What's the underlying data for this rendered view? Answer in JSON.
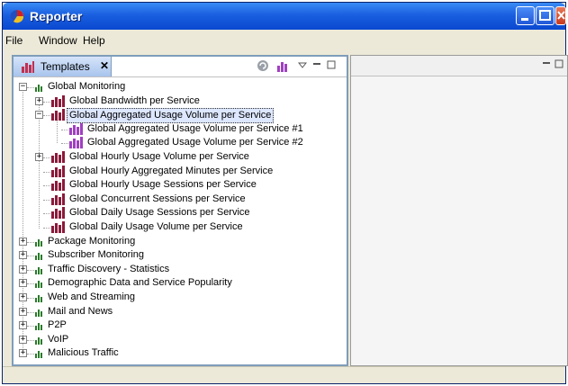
{
  "window": {
    "title": "Reporter"
  },
  "menu": [
    "File",
    "Window",
    "Help"
  ],
  "left_panel": {
    "tab_label": "Templates",
    "tab_close": "✕"
  },
  "tree": [
    {
      "label": "Global Monitoring",
      "level": 0,
      "icon": "folder",
      "expander": "−"
    },
    {
      "label": "Global Bandwidth per Service",
      "level": 1,
      "icon": "bar",
      "expander": "+"
    },
    {
      "label": "Global Aggregated Usage Volume per Service",
      "level": 1,
      "icon": "bar",
      "expander": "−",
      "selected": true
    },
    {
      "label": "Global Aggregated Usage Volume per Service #1",
      "level": 2,
      "icon": "bar-purple"
    },
    {
      "label": "Global Aggregated Usage Volume per Service #2",
      "level": 2,
      "icon": "bar-purple"
    },
    {
      "label": "Global Hourly Usage Volume per Service",
      "level": 1,
      "icon": "bar",
      "expander": "+"
    },
    {
      "label": "Global Hourly Aggregated Minutes per Service",
      "level": 1,
      "icon": "bar"
    },
    {
      "label": "Global Hourly Usage Sessions per Service",
      "level": 1,
      "icon": "bar"
    },
    {
      "label": "Global Concurrent Sessions per Service",
      "level": 1,
      "icon": "bar"
    },
    {
      "label": "Global Daily Usage Sessions per Service",
      "level": 1,
      "icon": "bar"
    },
    {
      "label": "Global Daily Usage Volume per Service",
      "level": 1,
      "icon": "bar"
    },
    {
      "label": "Package Monitoring",
      "level": 0,
      "icon": "folder",
      "expander": "+"
    },
    {
      "label": "Subscriber Monitoring",
      "level": 0,
      "icon": "folder",
      "expander": "+"
    },
    {
      "label": "Traffic Discovery - Statistics",
      "level": 0,
      "icon": "folder",
      "expander": "+"
    },
    {
      "label": "Demographic Data and Service Popularity",
      "level": 0,
      "icon": "folder",
      "expander": "+"
    },
    {
      "label": "Web and Streaming",
      "level": 0,
      "icon": "folder",
      "expander": "+"
    },
    {
      "label": "Mail and News",
      "level": 0,
      "icon": "folder",
      "expander": "+"
    },
    {
      "label": "P2P",
      "level": 0,
      "icon": "folder",
      "expander": "+"
    },
    {
      "label": "VoIP",
      "level": 0,
      "icon": "folder",
      "expander": "+"
    },
    {
      "label": "Malicious Traffic",
      "level": 0,
      "icon": "folder",
      "expander": "+"
    }
  ],
  "colors": {
    "titlebar": "#0a48d0",
    "bar_icon": "#8b1a3a",
    "bar_purple": "#a040c0",
    "folder_icon": "#2a7a2a"
  }
}
